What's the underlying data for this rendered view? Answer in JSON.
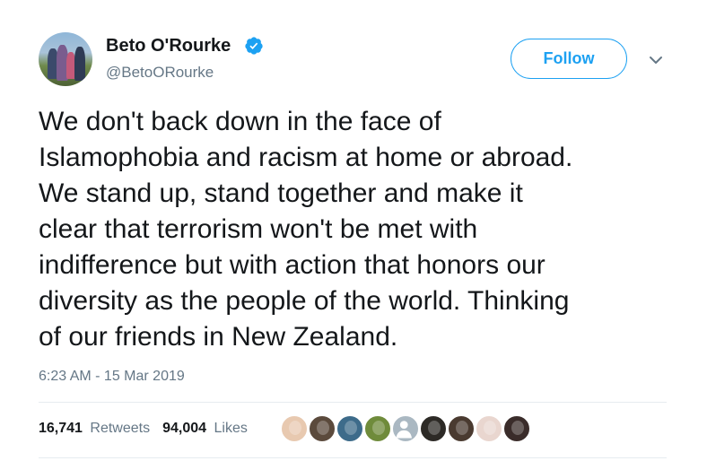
{
  "author": {
    "name": "Beto O'Rourke",
    "handle": "@BetoORourke",
    "verified_icon": "verified-badge-icon",
    "accent_color": "#1da1f2"
  },
  "actions": {
    "follow_label": "Follow",
    "menu_icon": "chevron-down-icon"
  },
  "tweet": {
    "text": "We don't back down in the face of\nIslamophobia and racism at home or abroad.\nWe stand up, stand together and make it\nclear that terrorism won't be met with\nindifference but with action that honors our\ndiversity as the people of the world. Thinking\nof our friends in New Zealand.",
    "timestamp": "6:23 AM - 15 Mar 2019"
  },
  "stats": {
    "retweets_count": "16,741",
    "retweets_label": "Retweets",
    "likes_count": "94,004",
    "likes_label": "Likes"
  },
  "likers": [
    {
      "name": "liker-avatar-1",
      "color": "#e8c9b0"
    },
    {
      "name": "liker-avatar-2",
      "color": "#5b4a3c"
    },
    {
      "name": "liker-avatar-3",
      "color": "#3d6b8a"
    },
    {
      "name": "liker-avatar-4",
      "color": "#6f8b3b"
    },
    {
      "name": "liker-avatar-5",
      "color": "#aab8c2"
    },
    {
      "name": "liker-avatar-6",
      "color": "#2d2a26"
    },
    {
      "name": "liker-avatar-7",
      "color": "#4a3a30"
    },
    {
      "name": "liker-avatar-8",
      "color": "#e9d6cf"
    },
    {
      "name": "liker-avatar-9",
      "color": "#3a2c2a"
    }
  ]
}
